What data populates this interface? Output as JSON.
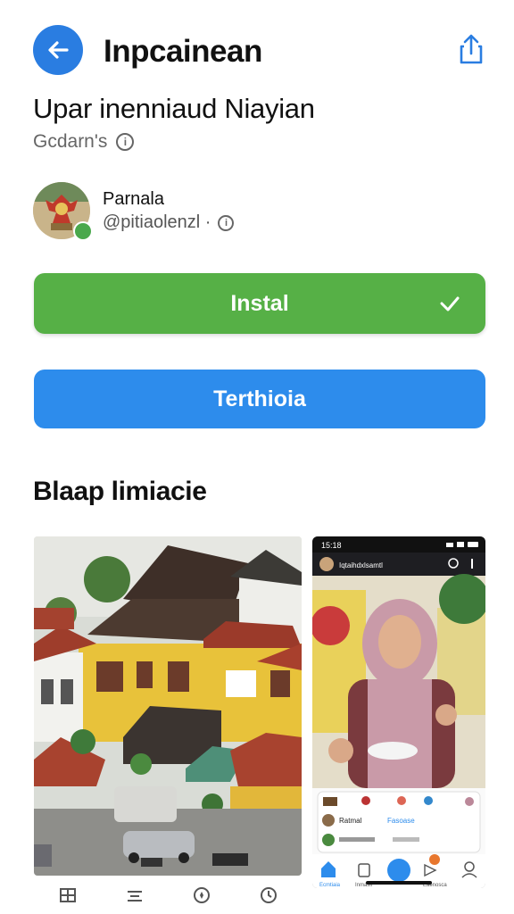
{
  "header": {
    "title": "Inpcainean",
    "back_icon": "arrow-left-icon",
    "share_icon": "share-icon"
  },
  "app": {
    "name": "Upar inenniaud Niayian",
    "subtitle": "Gcdarn's"
  },
  "developer": {
    "name": "Parnala",
    "handle": "@pitiaolenzl ·"
  },
  "buttons": {
    "install_label": "Instal",
    "secondary_label": "Terthioia"
  },
  "screenshots_section": {
    "title": "Blaap limiacie"
  },
  "phone_screenshot": {
    "status_time": "15:18",
    "app_bar_title": "Iqtaihdxlsamtl",
    "list_name": "Ratmal",
    "list_link": "Fasoase",
    "nav_labels": [
      "Ecmtiaia",
      "Inmasii",
      "Eaenosca"
    ]
  },
  "colors": {
    "install_green": "#56b046",
    "primary_blue": "#2d8cec",
    "back_blue": "#2a7de1"
  }
}
